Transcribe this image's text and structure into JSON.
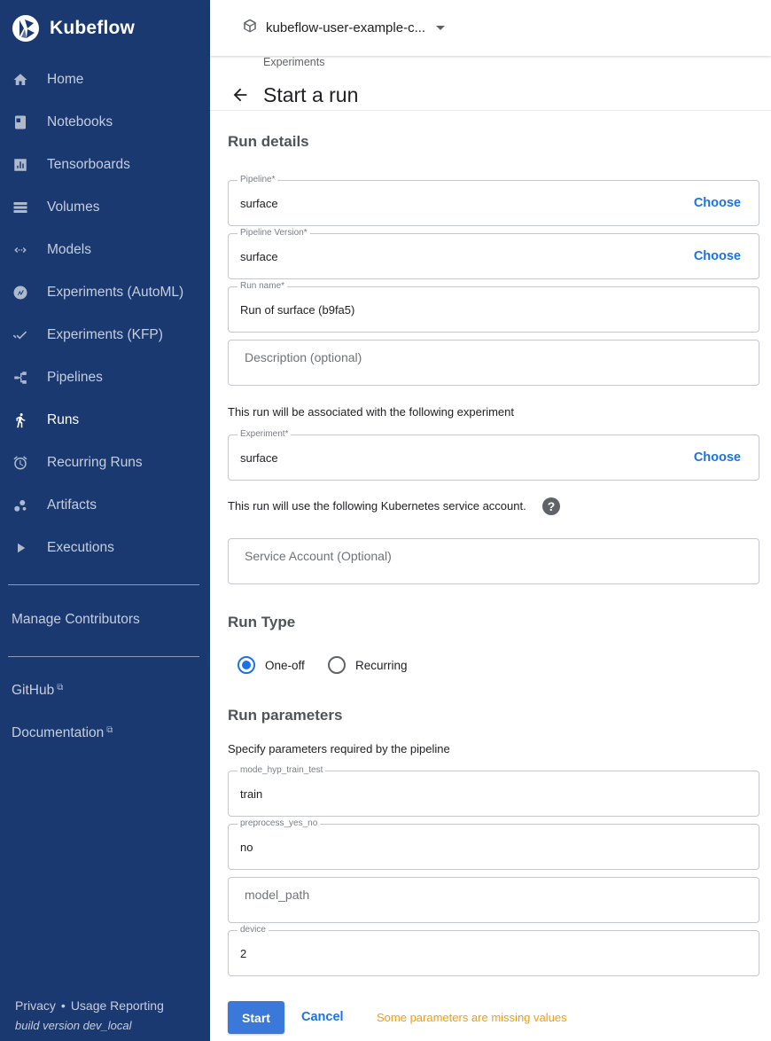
{
  "brand": {
    "name": "Kubeflow"
  },
  "sidebar": {
    "items": [
      {
        "label": "Home",
        "icon": "home-icon"
      },
      {
        "label": "Notebooks",
        "icon": "notebook-icon"
      },
      {
        "label": "Tensorboards",
        "icon": "tensorboard-icon"
      },
      {
        "label": "Volumes",
        "icon": "volumes-icon"
      },
      {
        "label": "Models",
        "icon": "models-icon"
      },
      {
        "label": "Experiments (AutoML)",
        "icon": "automl-icon"
      },
      {
        "label": "Experiments (KFP)",
        "icon": "kfp-icon"
      },
      {
        "label": "Pipelines",
        "icon": "pipelines-icon"
      },
      {
        "label": "Runs",
        "icon": "runs-icon",
        "active": true
      },
      {
        "label": "Recurring Runs",
        "icon": "alarm-icon"
      },
      {
        "label": "Artifacts",
        "icon": "artifacts-icon"
      },
      {
        "label": "Executions",
        "icon": "play-icon"
      }
    ],
    "manage_contributors": "Manage Contributors",
    "github": "GitHub",
    "documentation": "Documentation",
    "privacy": "Privacy",
    "separator": "•",
    "usage_reporting": "Usage Reporting",
    "build_version": "build version dev_local"
  },
  "topbar": {
    "namespace": "kubeflow-user-example-c..."
  },
  "header": {
    "breadcrumb": "Experiments",
    "title": "Start a run"
  },
  "run_details": {
    "title": "Run details",
    "pipeline": {
      "label": "Pipeline*",
      "value": "surface",
      "action": "Choose"
    },
    "pipeline_version": {
      "label": "Pipeline Version*",
      "value": "surface",
      "action": "Choose"
    },
    "run_name": {
      "label": "Run name*",
      "value": "Run of surface (b9fa5)"
    },
    "description": {
      "placeholder": "Description (optional)"
    },
    "experiment_note": "This run will be associated with the following experiment",
    "experiment": {
      "label": "Experiment*",
      "value": "surface",
      "action": "Choose"
    },
    "service_account_note": "This run will use the following Kubernetes service account.",
    "service_account": {
      "placeholder": "Service Account (Optional)"
    }
  },
  "run_type": {
    "title": "Run Type",
    "options": [
      {
        "label": "One-off",
        "selected": true
      },
      {
        "label": "Recurring",
        "selected": false
      }
    ]
  },
  "run_parameters": {
    "title": "Run parameters",
    "note": "Specify parameters required by the pipeline",
    "params": [
      {
        "label": "mode_hyp_train_test",
        "value": "train"
      },
      {
        "label": "preprocess_yes_no",
        "value": "no"
      },
      {
        "label": "model_path",
        "value": ""
      },
      {
        "label": "device",
        "value": "2"
      }
    ]
  },
  "actions": {
    "start": "Start",
    "cancel": "Cancel",
    "warning": "Some parameters are missing values"
  },
  "colors": {
    "sidebar": "#1a3971",
    "accent": "#1a73e8",
    "warning": "#f39c12"
  }
}
